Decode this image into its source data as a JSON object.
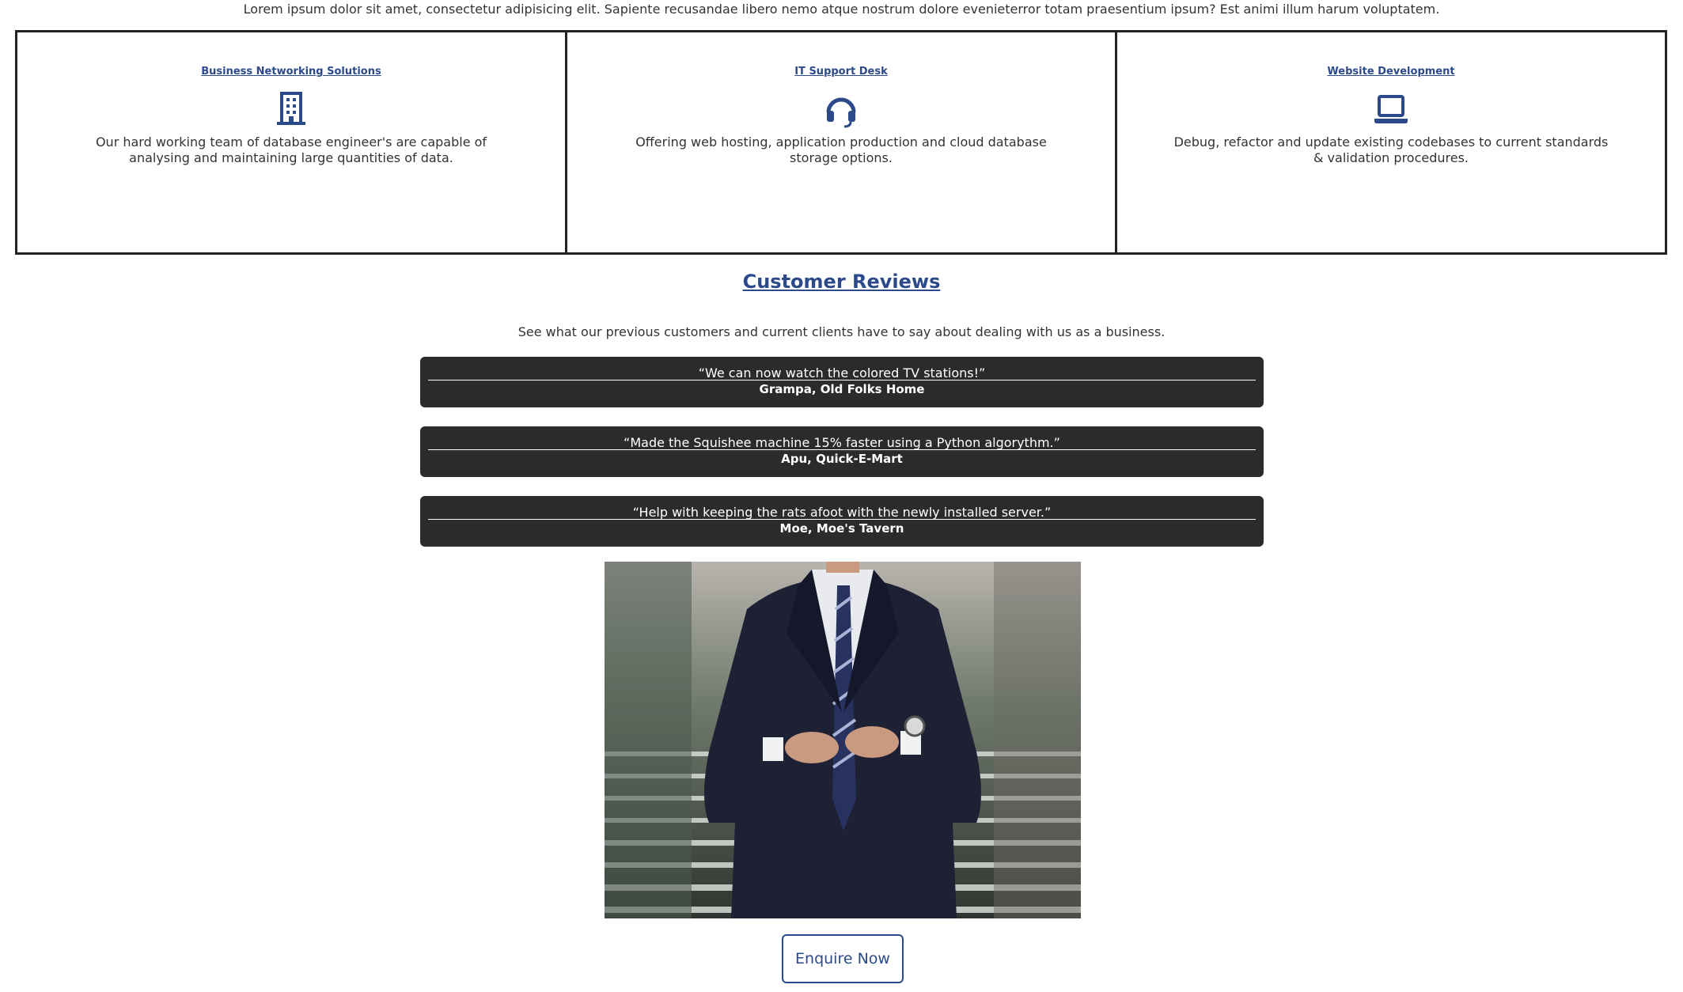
{
  "intro": {
    "text": "Lorem ipsum dolor sit amet, consectetur adipisicing elit. Sapiente recusandae libero nemo atque nostrum dolore evenieterror totam praesentium ipsum? Est animi illum harum voluptatem."
  },
  "services": [
    {
      "title": "Business Networking Solutions",
      "icon": "building-icon",
      "description": "Our hard working team of database engineer's are capable of analysing and maintaining large quantities of data."
    },
    {
      "title": "IT Support Desk",
      "icon": "headset-icon",
      "description": "Offering web hosting, application production and cloud database storage options."
    },
    {
      "title": "Website Development",
      "icon": "laptop-icon",
      "description": "Debug, refactor and update existing codebases to current standards & validation procedures."
    }
  ],
  "reviews": {
    "heading": "Customer Reviews",
    "subheading": "See what our previous customers and current clients have to say about dealing with us as a business.",
    "items": [
      {
        "quote": "“We can now watch the colored TV stations!”",
        "author": "Grampa, Old Folks Home"
      },
      {
        "quote": "“Made the Squishee machine 15% faster using a Python algorythm.”",
        "author": "Apu, Quick-E-Mart"
      },
      {
        "quote": "“Help with keeping the rats afoot with the newly installed server.”",
        "author": "Moe, Moe's Tavern"
      }
    ]
  },
  "cta": {
    "label": "Enquire Now"
  },
  "colors": {
    "accent": "#2c4a8a",
    "review_bg": "#2b2b2b"
  }
}
